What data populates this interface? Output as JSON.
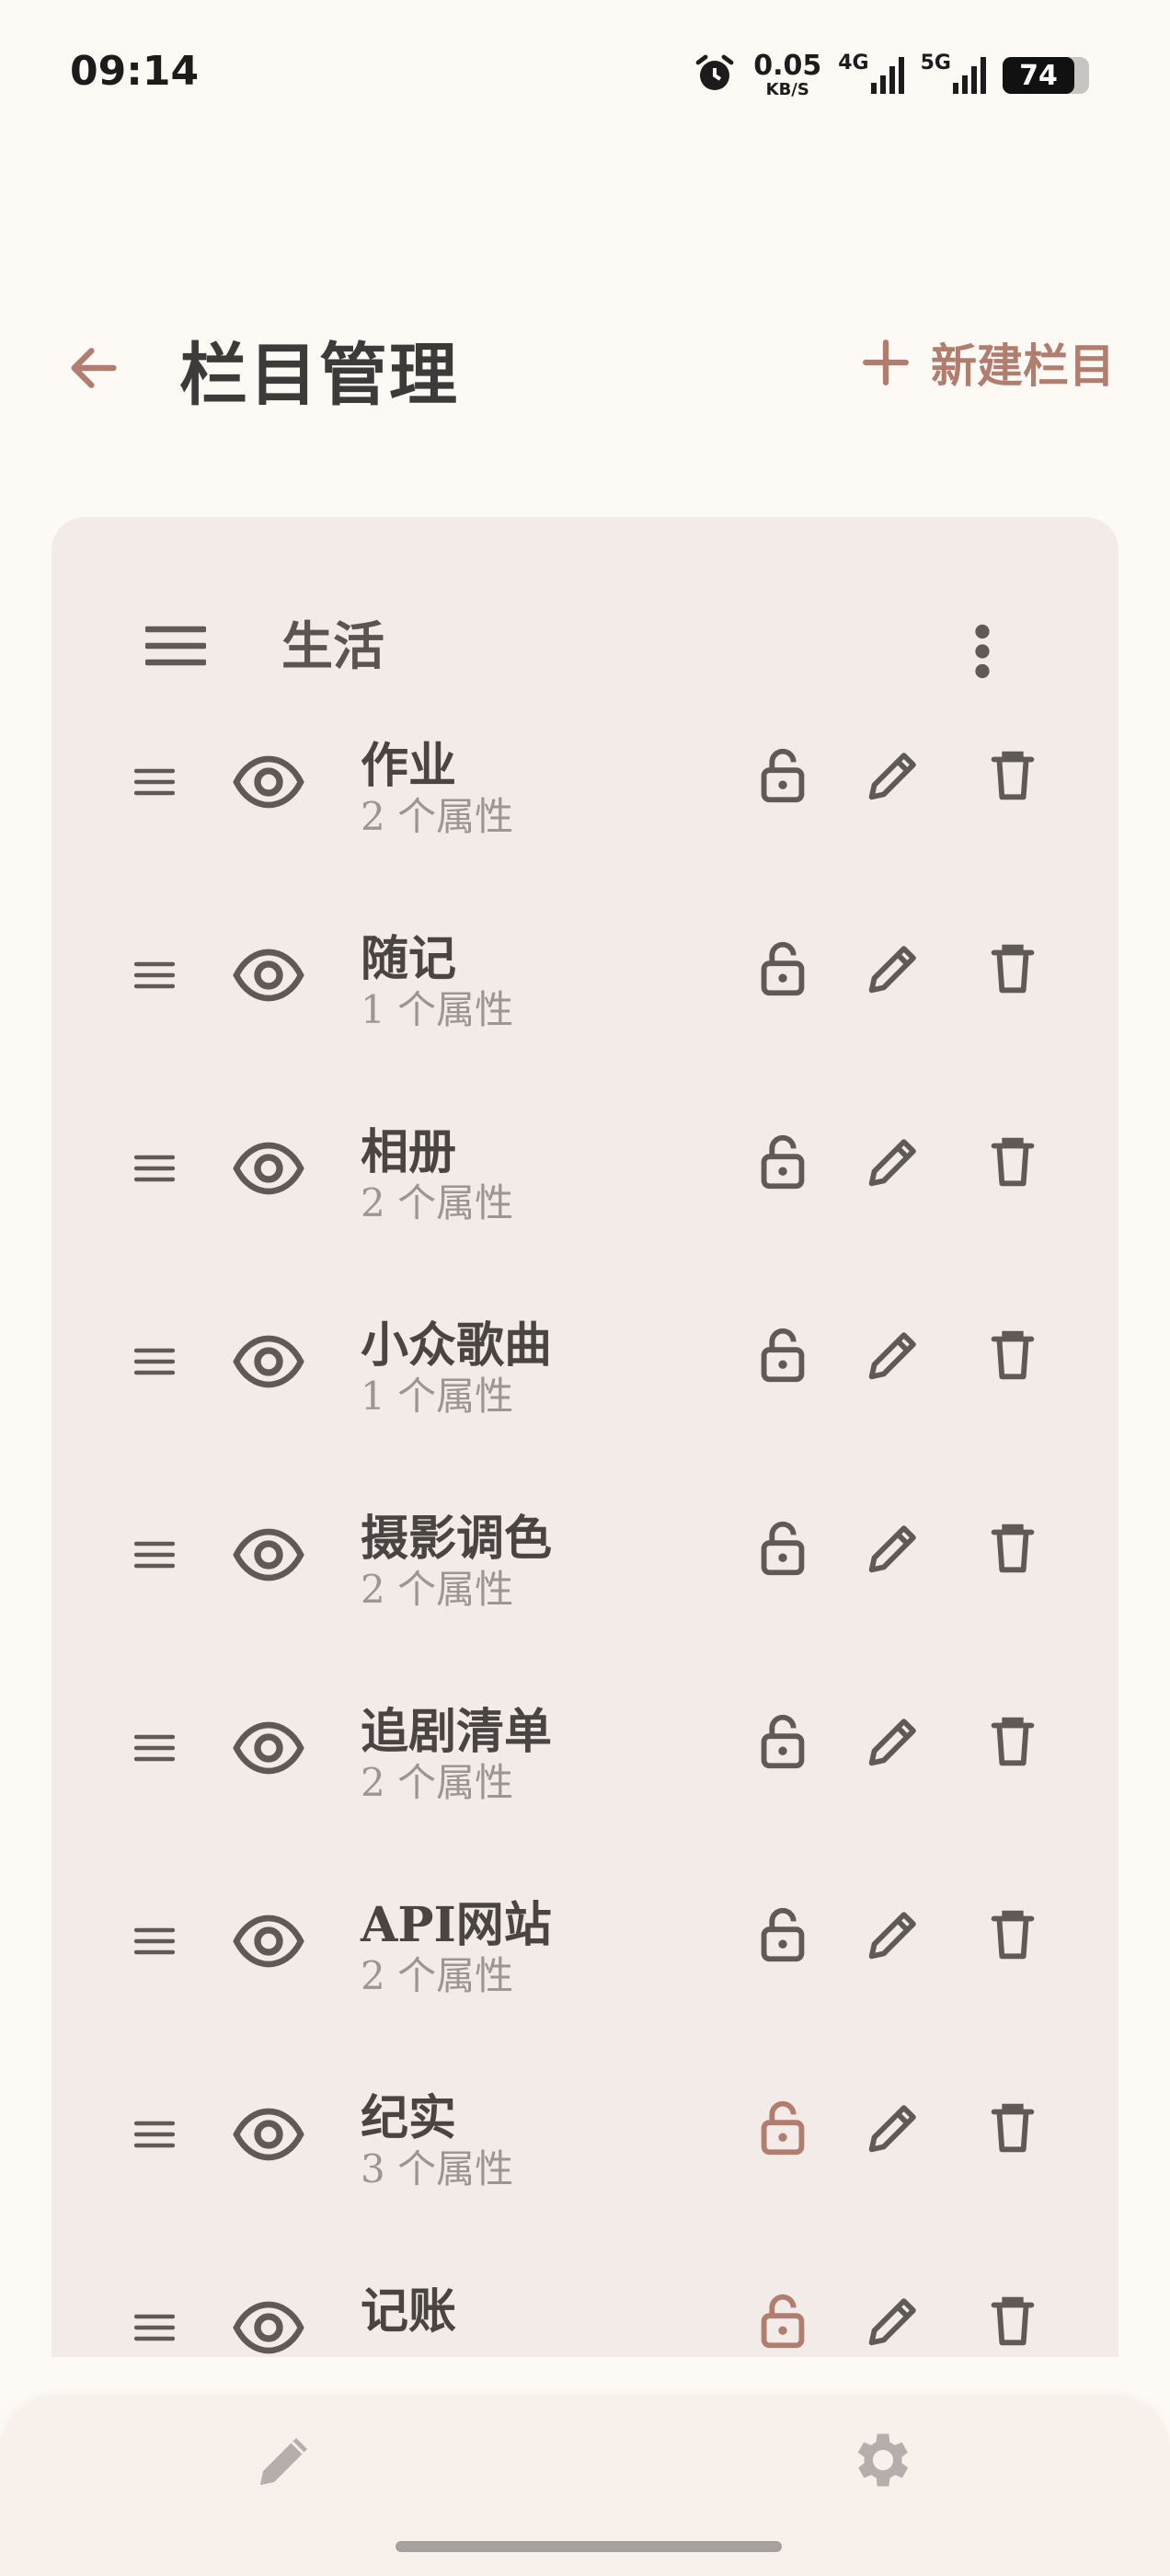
{
  "status_bar": {
    "time": "09:14",
    "net_speed": "0.05",
    "net_speed_unit": "KB/S",
    "net1": "4G",
    "net2": "5G",
    "battery": "74"
  },
  "header": {
    "title": "栏目管理",
    "new_label": "新建栏目"
  },
  "category": {
    "title": "生活"
  },
  "items": [
    {
      "name": "作业",
      "attrs": "2 个属性",
      "locked_highlight": false
    },
    {
      "name": "随记",
      "attrs": "1 个属性",
      "locked_highlight": false
    },
    {
      "name": "相册",
      "attrs": "2 个属性",
      "locked_highlight": false
    },
    {
      "name": "小众歌曲",
      "attrs": "1 个属性",
      "locked_highlight": false
    },
    {
      "name": "摄影调色",
      "attrs": "2 个属性",
      "locked_highlight": false
    },
    {
      "name": "追剧清单",
      "attrs": "2 个属性",
      "locked_highlight": false
    },
    {
      "name": "API网站",
      "attrs": "2 个属性",
      "locked_highlight": false
    },
    {
      "name": "纪实",
      "attrs": "3 个属性",
      "locked_highlight": true
    },
    {
      "name": "记账",
      "attrs": "",
      "locked_highlight": true
    }
  ],
  "colors": {
    "accent": "#b07d6f",
    "icon": "#5f5958",
    "card_bg": "#f2ebe7",
    "page_bg": "#fdfaf6"
  }
}
